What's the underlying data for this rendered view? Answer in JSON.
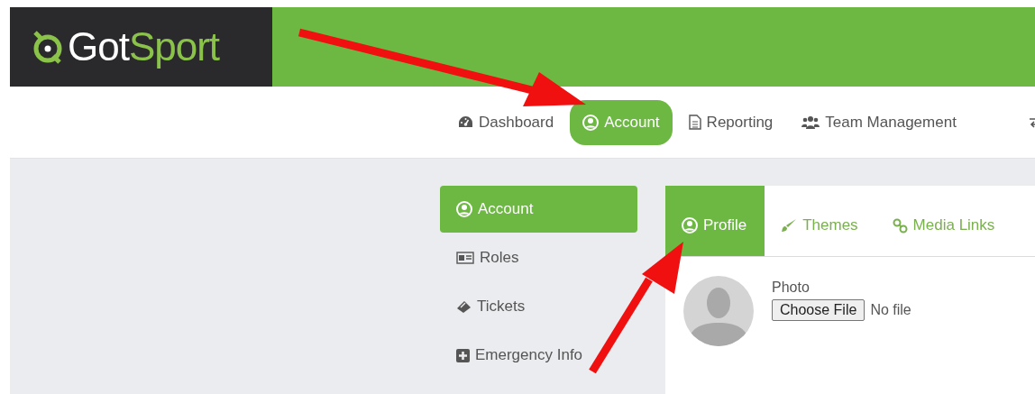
{
  "logo": {
    "parts": [
      "Got",
      "Sport"
    ]
  },
  "nav": [
    {
      "label": "Dashboard",
      "selected": false
    },
    {
      "label": "Account",
      "selected": true
    },
    {
      "label": "Reporting",
      "selected": false
    },
    {
      "label": "Team Management",
      "selected": false
    }
  ],
  "sidebar": {
    "items": [
      {
        "label": "Account",
        "selected": true
      },
      {
        "label": "Roles",
        "selected": false
      },
      {
        "label": "Tickets",
        "selected": false
      },
      {
        "label": "Emergency Info",
        "selected": false
      }
    ]
  },
  "tabs": [
    {
      "label": "Profile",
      "selected": true
    },
    {
      "label": "Themes",
      "selected": false
    },
    {
      "label": "Media Links",
      "selected": false
    }
  ],
  "photo": {
    "label": "Photo",
    "button": "Choose File",
    "status": "No file"
  }
}
